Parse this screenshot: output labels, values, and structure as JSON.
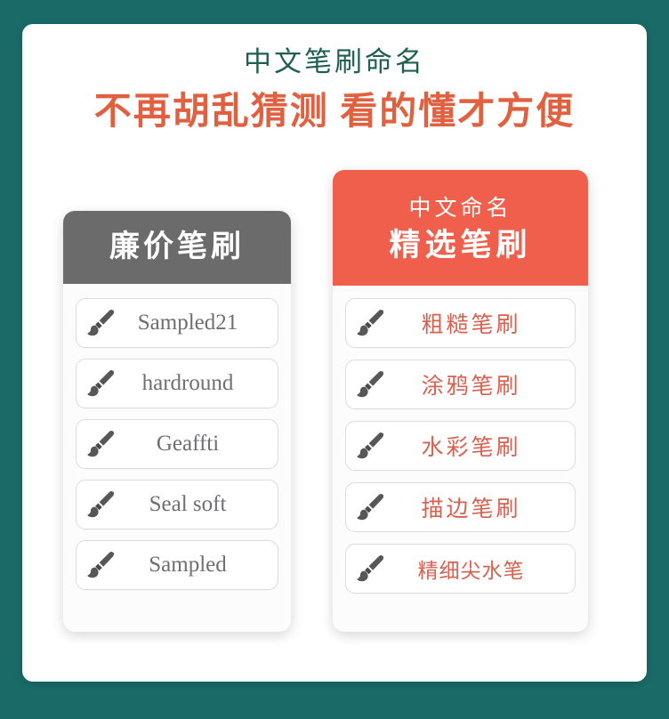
{
  "page": {
    "background_color": "#1a6b68",
    "panel_background": "#ffffff"
  },
  "header": {
    "title": "中文笔刷命名",
    "title_color": "#1f5f52",
    "subtitle": "不再胡乱猜测 看的懂才方便",
    "subtitle_color": "#e0603f"
  },
  "cards": [
    {
      "id": "cheap-brushes",
      "header_title": "廉价笔刷",
      "header_subtitle": "",
      "header_color": "#6b6b6b",
      "label_color": "#6e6e73",
      "items": [
        {
          "icon": "paintbrush-icon",
          "label": "Sampled21"
        },
        {
          "icon": "paintbrush-icon",
          "label": "hardround"
        },
        {
          "icon": "paintbrush-icon",
          "label": "Geaffti"
        },
        {
          "icon": "paintbrush-icon",
          "label": "Seal soft"
        },
        {
          "icon": "paintbrush-icon",
          "label": "Sampled"
        }
      ]
    },
    {
      "id": "curated-brushes",
      "header_title": "精选笔刷",
      "header_subtitle": "中文命名",
      "header_color": "#ef5f4c",
      "label_color": "#d9604f",
      "items": [
        {
          "icon": "paintbrush-icon",
          "label": "粗糙笔刷"
        },
        {
          "icon": "paintbrush-icon",
          "label": "涂鸦笔刷"
        },
        {
          "icon": "paintbrush-icon",
          "label": "水彩笔刷"
        },
        {
          "icon": "paintbrush-icon",
          "label": "描边笔刷"
        },
        {
          "icon": "paintbrush-icon",
          "label": "精细尖水笔"
        }
      ]
    }
  ]
}
